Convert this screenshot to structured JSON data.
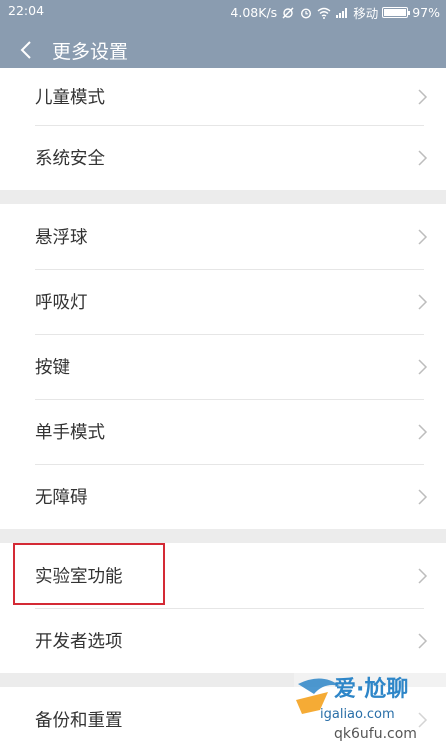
{
  "status_bar": {
    "time": "22:04",
    "speed": "4.08K/s",
    "carrier": "移动",
    "battery": "97%",
    "battery_level": 0.97
  },
  "header": {
    "title": "更多设置"
  },
  "groups": [
    [
      "儿童模式",
      "系统安全"
    ],
    [
      "悬浮球",
      "呼吸灯",
      "按键",
      "单手模式",
      "无障碍"
    ],
    [
      "实验室功能",
      "开发者选项"
    ],
    [
      "备份和重置"
    ]
  ],
  "watermark": {
    "line1": "爱·尬聊",
    "line2": "igaliao.com",
    "line3": "qk6ufu.com"
  },
  "colors": {
    "bar": "#8a9cb0",
    "highlight": "#d42a35"
  }
}
